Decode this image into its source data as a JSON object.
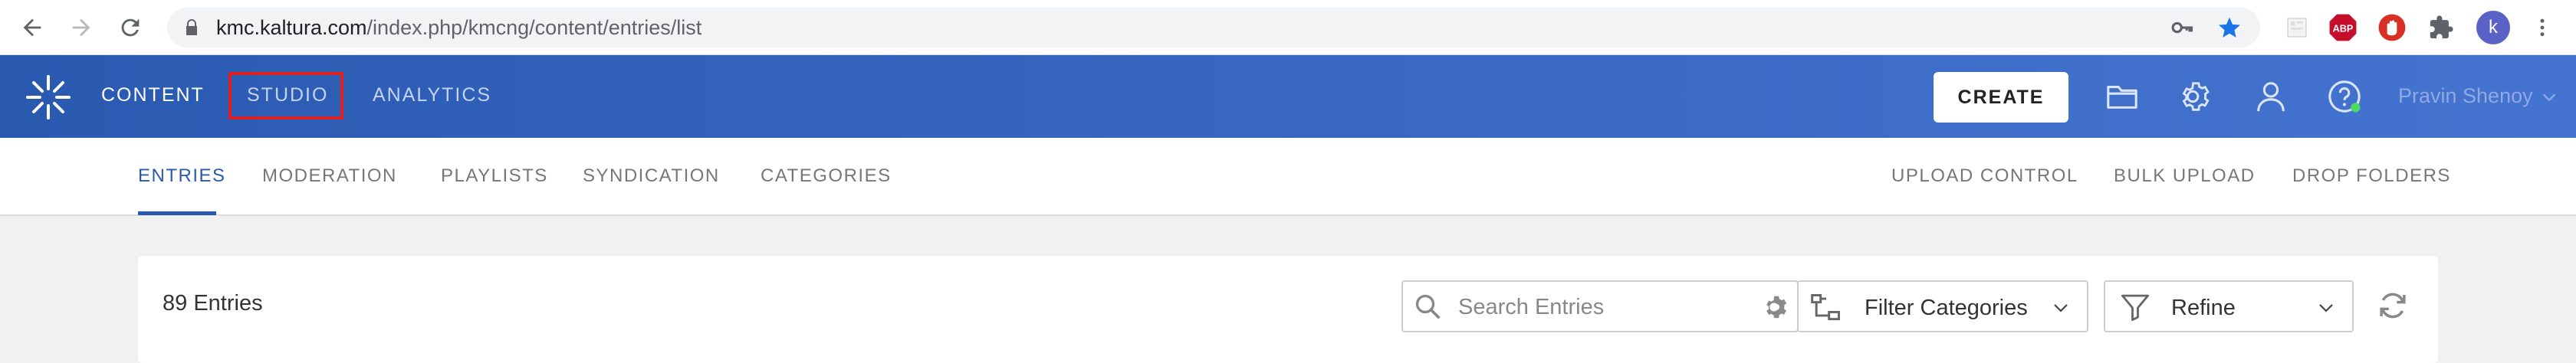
{
  "browser": {
    "url_host": "kmc.kaltura.com",
    "url_path": "/index.php/kmcng/content/entries/list",
    "profile_initial": "k",
    "abp_label": "ABP"
  },
  "header": {
    "nav": [
      {
        "label": "CONTENT"
      },
      {
        "label": "STUDIO"
      },
      {
        "label": "ANALYTICS"
      }
    ],
    "create_label": "CREATE",
    "user_name": "Pravin Shenoy"
  },
  "sub_nav": {
    "left": [
      {
        "label": "ENTRIES"
      },
      {
        "label": "MODERATION"
      },
      {
        "label": "PLAYLISTS"
      },
      {
        "label": "SYNDICATION"
      },
      {
        "label": "CATEGORIES"
      }
    ],
    "right": [
      {
        "label": "UPLOAD CONTROL"
      },
      {
        "label": "BULK UPLOAD"
      },
      {
        "label": "DROP FOLDERS"
      }
    ]
  },
  "content": {
    "entries_count": "89 Entries",
    "search_placeholder": "Search Entries",
    "filter_label": "Filter Categories",
    "refine_label": "Refine"
  },
  "colors": {
    "header_blue": "#2a5ab0",
    "highlight_red": "#e02020",
    "star_blue": "#1a73e8"
  }
}
